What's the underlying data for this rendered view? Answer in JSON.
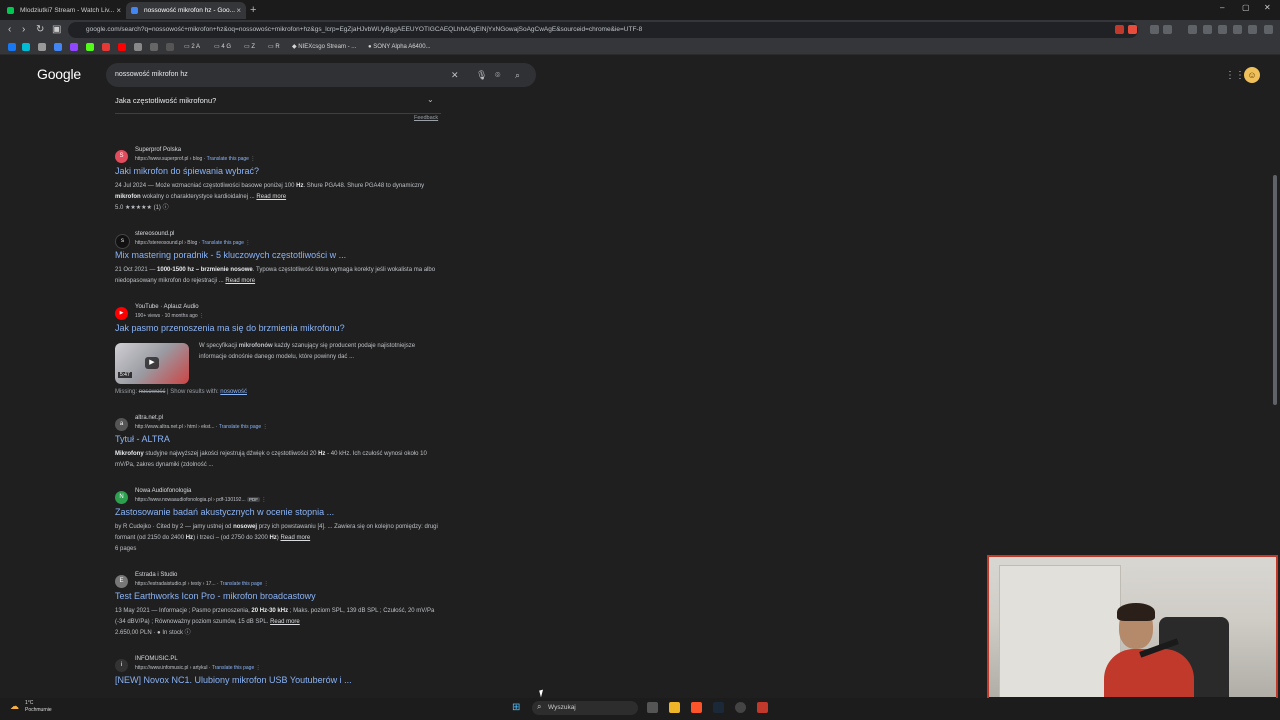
{
  "browser": {
    "tabs": [
      {
        "title": "Mlodziutki7 Stream - Watch Liv...",
        "favicon_color": "#00c853"
      },
      {
        "title": "nossowość mikrofon hz - Goo...",
        "favicon_color": "#4285f4"
      }
    ],
    "url": "google.com/search?q=nossowość+mikrofon+hz&oq=nossowośc+mikrofon+hz&gs_lcrp=EgZjaHJvbWUyBggAEEUYOTIGCAEQLhhA0gEINjYxNGowajSoAgCwAgE&sourceid=chrome&ie=UTF-8",
    "bookmarks": [
      "2 A",
      "4 G",
      "Z",
      "R",
      "NIEXcsgo Stream - ...",
      "SONY Alpha A6400..."
    ]
  },
  "google": {
    "logo": "Google",
    "query": "nossowość mikrofon hz",
    "paa_question": "Jaka częstotliwość mikrofonu?",
    "feedback": "Feedback",
    "read_more": "Read more",
    "translate": "Translate this page",
    "results": [
      {
        "site": "Superprof Polska",
        "url": "https://www.superprof.pl › blog",
        "title": "Jaki mikrofon do śpiewania wybrać?",
        "snippet_date": "24 Jul 2024",
        "snippet_a": " — Może wzmacniać częstotliwości basowe poniżej 100 ",
        "snippet_b": "Hz",
        "snippet_c": ". Shure PGA48. Shure PGA48 to dynamiczny ",
        "snippet_d": "mikrofon",
        "snippet_e": " wokalny o charakterystyce kardioidalnej ...",
        "rating": "5.0 ★★★★★ (1)",
        "fav": "S",
        "fav_color": "#e24b5b"
      },
      {
        "site": "stereosound.pl",
        "url": "https://stereosound.pl › Blog",
        "title": "Mix mastering poradnik - 5 kluczowych częstotliwości w ...",
        "snippet_date": "21 Oct 2021",
        "snippet_a": " — ",
        "snippet_b": "1000-1500 hz – brzmienie nosowe",
        "snippet_c": ". Typowa częstotliwość która wymaga korekty jeśli wokalista ma albo niedopasowany mikrofon do rejestracji ...",
        "fav": "s",
        "fav_color": "#111"
      },
      {
        "site": "YouTube · Aplauz Audio",
        "url": "190+ views · 10 months ago",
        "title": "Jak pasmo przenoszenia ma się do brzmienia mikrofonu?",
        "snippet_a": "W specyfikacji ",
        "snippet_b": "mikrofonów",
        "snippet_c": " każdy szanujący się producent podaje najistotniejsze informacje odnośnie danego modelu, które powinny dać ...",
        "duration": "5:47",
        "fav": "▶",
        "fav_color": "#ff0000"
      },
      {
        "site": "altra.net.pl",
        "url": "http://www.altra.net.pl › html › ekst...",
        "title": "Tytuł - ALTRA",
        "snippet_a": "Mikrofony",
        "snippet_b": " studyjne najwyższej jakości rejestrują dźwięk o częstotliwości 20 ",
        "snippet_c": "Hz",
        "snippet_d": " - 40 kHz. Ich czułość wynosi około 10 mV/Pa, zakres dynamiki (zdolność ...",
        "fav": "a",
        "fav_color": "#555"
      },
      {
        "site": "Nowa Audiofonologia",
        "url": "https://www.nowaaudiofonologia.pl › pdf-130192...",
        "pdf": "PDF",
        "title": "Zastosowanie badań akustycznych w ocenie stopnia ...",
        "snippet_a": "by R Cudejko · Cited by 2 — jamy ustnej od ",
        "snippet_b": "nosowej",
        "snippet_c": " przy ich powstawaniu [4]. ... Zawiera się on kolejno pomiędzy: drugi formant (od 2150 do 2400 ",
        "snippet_d": "Hz",
        "snippet_e": ") i trzeci – (od 2750 do 3200 ",
        "snippet_f": "Hz",
        "snippet_g": ")",
        "pages": "6 pages",
        "fav": "N",
        "fav_color": "#2e9e4f"
      },
      {
        "site": "Estrada i Studio",
        "url": "https://estradaistudio.pl › testy › 17...",
        "title": "Test Earthworks Icon Pro - mikrofon broadcastowy",
        "snippet_date": "13 May 2021",
        "snippet_a": " — Informacje ; Pasmo przenoszenia, ",
        "snippet_b": "20 Hz-30 kHz",
        "snippet_c": " ; Maks. poziom SPL, 139 dB SPL ; Czułość, 20 mV/Pa (-34 dBV/Pa) ; Równoważny poziom szumów, 15 dB SPL.",
        "price": "2.650,00 PLN · ● In stock",
        "fav": "E",
        "fav_color": "#777"
      },
      {
        "site": "INFOMUSIC.PL",
        "url": "https://www.infomusic.pl › artykul",
        "title": "[NEW] Novox NC1. Ulubiony mikrofon USB Youtuberów i ...",
        "fav": "i",
        "fav_color": "#333"
      }
    ],
    "missing_label": "Missing:",
    "missing_word": "nosowość",
    "show_results": "| Show results with:",
    "show_word": "nosowość"
  },
  "taskbar": {
    "weather_temp": "1°C",
    "weather_desc": "Pochmurnie",
    "search_placeholder": "Wyszukaj"
  },
  "colors": {
    "link": "#8ab4f8",
    "accent_red": "#c0392b",
    "bg": "#1f1f1f"
  }
}
